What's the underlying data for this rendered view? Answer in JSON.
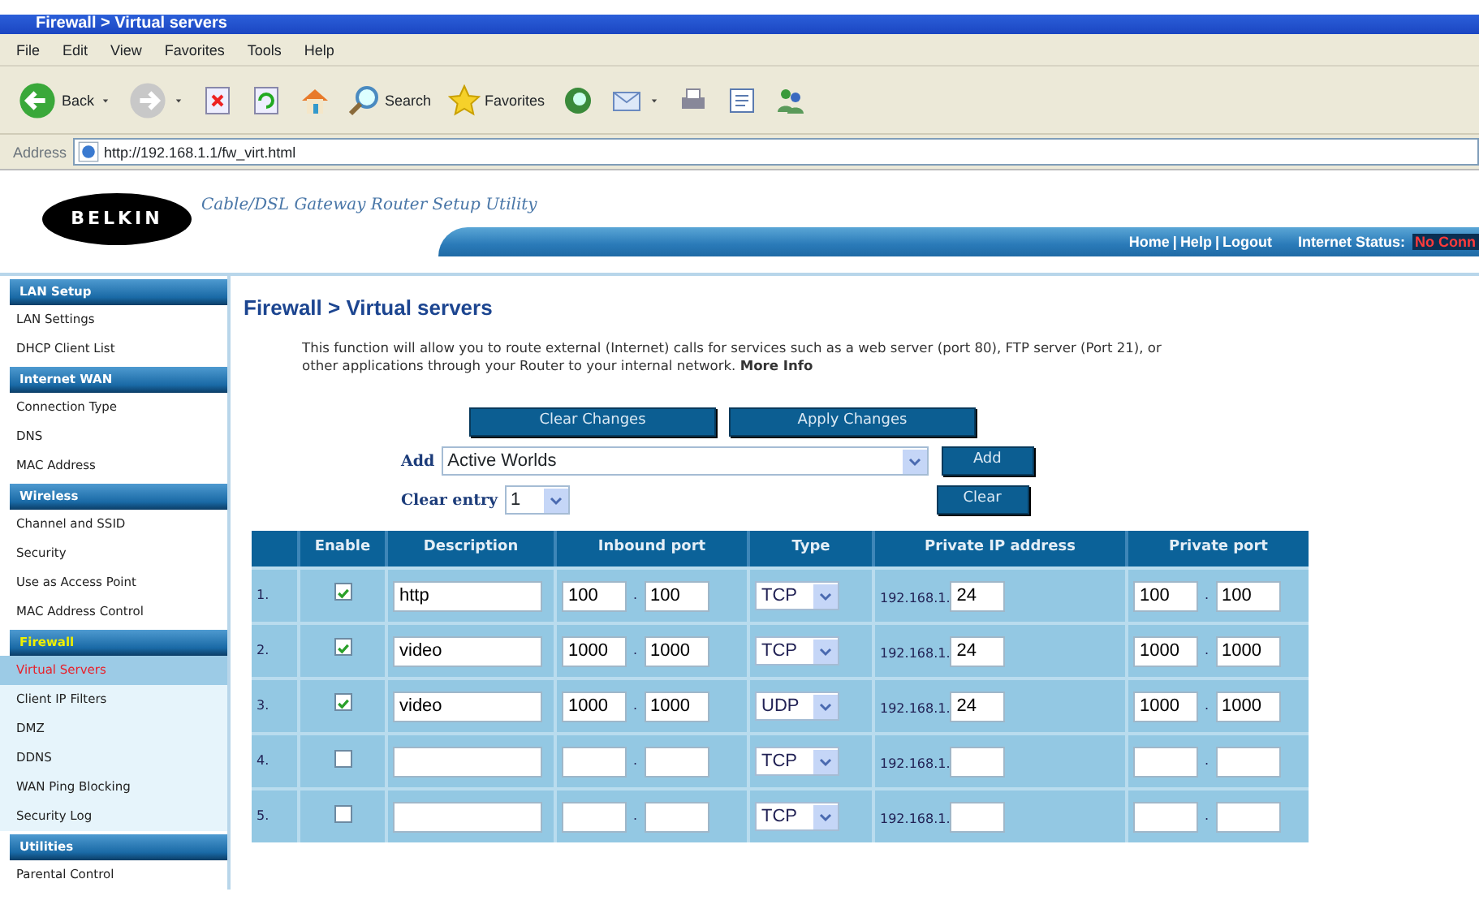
{
  "browser": {
    "title": "Firewall > Virtual servers",
    "menu": [
      "File",
      "Edit",
      "View",
      "Favorites",
      "Tools",
      "Help"
    ],
    "toolbar": [
      {
        "kind": "back",
        "label": "Back",
        "dropdown": true
      },
      {
        "kind": "forward",
        "dropdown": true
      },
      {
        "kind": "stop"
      },
      {
        "kind": "refresh"
      },
      {
        "kind": "home"
      },
      {
        "kind": "search",
        "label": "Search"
      },
      {
        "kind": "favorites",
        "label": "Favorites"
      },
      {
        "kind": "media"
      },
      {
        "kind": "mail",
        "dropdown": true
      },
      {
        "kind": "print"
      },
      {
        "kind": "edit"
      },
      {
        "kind": "messenger"
      }
    ],
    "address_label": "Address",
    "url": "http://192.168.1.1/fw_virt.html"
  },
  "header": {
    "brand": "BELKIN",
    "tagline": "Cable/DSL Gateway Router Setup Utility",
    "links": [
      "Home",
      "Help",
      "Logout"
    ],
    "link_separator": "|",
    "status_label": "Internet Status:",
    "status_value": "No Conn"
  },
  "sidebar": [
    {
      "title": "LAN Setup",
      "selected": false,
      "items": [
        {
          "label": "LAN Settings",
          "selected": false
        },
        {
          "label": "DHCP Client List",
          "selected": false
        }
      ]
    },
    {
      "title": "Internet WAN",
      "selected": false,
      "items": [
        {
          "label": "Connection Type",
          "selected": false
        },
        {
          "label": "DNS",
          "selected": false
        },
        {
          "label": "MAC Address",
          "selected": false
        }
      ]
    },
    {
      "title": "Wireless",
      "selected": false,
      "items": [
        {
          "label": "Channel and SSID",
          "selected": false
        },
        {
          "label": "Security",
          "selected": false
        },
        {
          "label": "Use as Access Point",
          "selected": false
        },
        {
          "label": "MAC Address Control",
          "selected": false
        }
      ]
    },
    {
      "title": "Firewall",
      "selected": true,
      "items": [
        {
          "label": "Virtual Servers",
          "selected": true
        },
        {
          "label": "Client IP Filters",
          "selected": false
        },
        {
          "label": "DMZ",
          "selected": false
        },
        {
          "label": "DDNS",
          "selected": false
        },
        {
          "label": "WAN Ping Blocking",
          "selected": false
        },
        {
          "label": "Security Log",
          "selected": false
        }
      ]
    },
    {
      "title": "Utilities",
      "selected": false,
      "items": [
        {
          "label": "Parental Control",
          "selected": false
        }
      ]
    }
  ],
  "content": {
    "heading": "Firewall > Virtual servers",
    "intro": "This function will allow you to route external (Internet) calls for services such as a web server (port 80), FTP server (Port 21), or other applications through your Router to your internal network.",
    "intro_link": "More Info",
    "buttons": [
      "Clear Changes",
      "Apply Changes"
    ],
    "add_label": "Add",
    "add_value": "Active Worlds",
    "add_button": "Add",
    "clear_label": "Clear entry",
    "clear_value": "1",
    "clear_button": "Clear",
    "table": {
      "columns": [
        "Enable",
        "Description",
        "Inbound port",
        "Type",
        "Private IP address",
        "Private port"
      ],
      "rows": [
        {
          "index": "1.",
          "enabled": true,
          "description": "http",
          "inbound_from": "100",
          "inbound_to": "100",
          "separator": ".",
          "type": "TCP",
          "ip_prefix": "192.168.1.",
          "ip_suffix": "24",
          "private_from": "100",
          "private_to": "100"
        },
        {
          "index": "2.",
          "enabled": true,
          "description": "video",
          "inbound_from": "1000",
          "inbound_to": "1000",
          "separator": ".",
          "type": "TCP",
          "ip_prefix": "192.168.1.",
          "ip_suffix": "24",
          "private_from": "1000",
          "private_to": "1000"
        },
        {
          "index": "3.",
          "enabled": true,
          "description": "video",
          "inbound_from": "1000",
          "inbound_to": "1000",
          "separator": ".",
          "type": "UDP",
          "ip_prefix": "192.168.1.",
          "ip_suffix": "24",
          "private_from": "1000",
          "private_to": "1000"
        },
        {
          "index": "4.",
          "enabled": false,
          "separator": ".",
          "type": "TCP",
          "ip_prefix": "192.168.1."
        },
        {
          "index": "5.",
          "enabled": false,
          "separator": ".",
          "type": "TCP",
          "ip_prefix": "192.168.1."
        }
      ]
    }
  }
}
